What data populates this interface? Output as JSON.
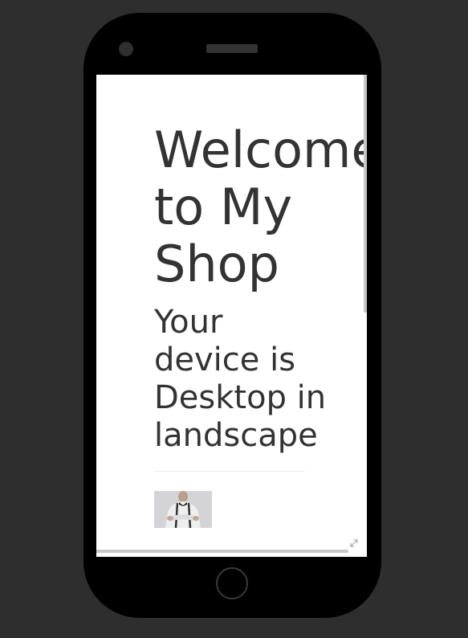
{
  "device_frame": {
    "camera_icon": "camera-icon",
    "speaker_icon": "speaker-grille",
    "home_icon": "home-button-icon"
  },
  "page": {
    "heading": "Welcome to My Shop",
    "device_message": "Your device is Desktop in landscape"
  },
  "product": {
    "image_icon": "man-in-suspenders-photo"
  },
  "icons": {
    "resize": "resize-diagonal-icon"
  },
  "colors": {
    "background": "#2e2e2e",
    "phone_body": "#000000",
    "screen": "#ffffff",
    "text": "#333333",
    "scrollbar": "#c8c8c8"
  }
}
